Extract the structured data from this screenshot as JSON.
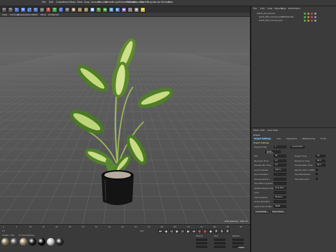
{
  "menubar": [
    "File",
    "Edit",
    "Create",
    "Select",
    "Tools",
    "Mesh",
    "Snap",
    "Animate",
    "Simulate",
    "Render",
    "Sculpt",
    "Motion Tracker",
    "MoGraph",
    "Character",
    "Pipeline",
    "Plugins",
    "Script",
    "Window",
    "Help"
  ],
  "toolbar": {
    "buttons": [
      {
        "icon": "undo-icon",
        "glyph": "↶",
        "color": "#5c5c5c"
      },
      {
        "icon": "redo-icon",
        "glyph": "↷",
        "color": "#5c5c5c"
      },
      {
        "icon": "live-select-icon",
        "glyph": "↖",
        "color": "#4a73c4"
      },
      {
        "icon": "move-icon",
        "glyph": "✥",
        "color": "#4a73c4"
      },
      {
        "icon": "scale-icon",
        "glyph": "⤢",
        "color": "#4a73c4"
      },
      {
        "icon": "rotate-icon",
        "glyph": "↻",
        "color": "#4a73c4"
      },
      {
        "icon": "last-tool-icon",
        "glyph": "◎",
        "color": "#5c5c5c"
      },
      {
        "icon": "x-axis-icon",
        "glyph": "X",
        "color": "#b84040"
      },
      {
        "icon": "y-axis-icon",
        "glyph": "Y",
        "color": "#4ea04e"
      },
      {
        "icon": "z-axis-icon",
        "glyph": "Z",
        "color": "#4863b8"
      },
      {
        "icon": "coordinate-system-icon",
        "glyph": "⊕",
        "color": "#5c5c5c"
      },
      {
        "icon": "render-view-icon",
        "glyph": "▣",
        "color": "#7a5e3c"
      },
      {
        "icon": "render-picture-viewer-icon",
        "glyph": "▤",
        "color": "#7a5e3c"
      },
      {
        "icon": "render-settings-icon",
        "glyph": "▥",
        "color": "#7a5e3c"
      },
      {
        "icon": "cube-icon",
        "glyph": "■",
        "color": "#3a6fb5"
      },
      {
        "icon": "pen-icon",
        "glyph": "✎",
        "color": "#5c8a3c"
      },
      {
        "icon": "subdivision-icon",
        "glyph": "◈",
        "color": "#3a8f3a"
      },
      {
        "icon": "array-icon",
        "glyph": "▦",
        "color": "#3a6fb5"
      },
      {
        "icon": "boole-icon",
        "glyph": "◐",
        "color": "#3a6fb5"
      },
      {
        "icon": "deformer-icon",
        "glyph": "◆",
        "color": "#7b5ab5"
      },
      {
        "icon": "floor-icon",
        "glyph": "▭",
        "color": "#7a7a7a"
      },
      {
        "icon": "camera-icon",
        "glyph": "◉",
        "color": "#7a7a7a"
      },
      {
        "icon": "light-icon",
        "glyph": "✺",
        "color": "#c9a83a"
      }
    ]
  },
  "viewport": {
    "menu": [
      "View",
      "Cameras",
      "Display",
      "Options",
      "Filter",
      "Panel",
      "ProRender"
    ],
    "grid_spacing": "Grid Spacing : 100 cm"
  },
  "object_manager": {
    "menu": [
      "File",
      "Edit",
      "View",
      "Objects",
      "Tags",
      "Bookmarks"
    ],
    "objects": [
      "plant_obj_Corona",
      "plant_001_Corona_Dieffenbachia",
      "plant_001_Corona_pot"
    ],
    "tag_colors": [
      "#58b04f",
      "#d08a3a",
      "#c04a4a",
      "#9c9c9c"
    ]
  },
  "attributes": {
    "menu": [
      "Mode",
      "Edit",
      "User Data"
    ],
    "title": "Project",
    "tabs": [
      "Project Settings",
      "Info",
      "Dynamics",
      "Referencing",
      "To Do"
    ],
    "section": "Project Settings",
    "rows": [
      {
        "label": "Project Scale",
        "value": "1",
        "value2": "Centimeters"
      },
      {
        "label": "",
        "value": "Scale Project..."
      },
      {
        "label": "FPS",
        "value": "30",
        "label2": "Project Time",
        "value2": "0 F"
      },
      {
        "label": "Minimum Time",
        "value": "0 F",
        "label2": "Maximum Time",
        "value2": "90 F"
      },
      {
        "label": "Preview Min Time",
        "value": "0 F",
        "label2": "Preview Max Time",
        "value2": "90 F"
      },
      {
        "label": "Level of Detail",
        "value": "100 %",
        "label2": "Render LOD in Editor",
        "value2": ""
      },
      {
        "label": "Use Animation",
        "value": "",
        "label2": "Use Expressions",
        "value2": ""
      },
      {
        "label": "Use Generators",
        "value": "",
        "label2": "Use Deformers",
        "value2": ""
      },
      {
        "label": "Use Motion System",
        "value": ""
      },
      {
        "label": "Default Object Color",
        "value": "Gray Blue"
      },
      {
        "label": "Color",
        "value": ""
      },
      {
        "label": "View Clipping",
        "value": "Medium"
      },
      {
        "label": "Linear Workflow",
        "value": ""
      },
      {
        "label": "Input Color Profile",
        "value": "sRGB"
      }
    ],
    "buttons": [
      "Load Preset...",
      "Save Preset..."
    ]
  },
  "timeline": {
    "ticks": [
      "0",
      "5",
      "10",
      "15",
      "20",
      "25",
      "30",
      "35",
      "40",
      "45",
      "50",
      "55",
      "60",
      "65",
      "70",
      "75",
      "80",
      "85",
      "90"
    ],
    "start_frame": "0 F",
    "end_frame": "90 F",
    "materials_menu": [
      "Create",
      "Edit",
      "Function",
      "Texture"
    ],
    "materials": [
      "#8a7a5c",
      "#555555",
      "#9f8f6f",
      "#1e1e1e",
      "#0f0f0f",
      "#cfcfcf",
      "#2c2c2c"
    ],
    "coords": [
      "Position",
      "Size",
      "Rotation"
    ],
    "apply_label": "Apply"
  }
}
